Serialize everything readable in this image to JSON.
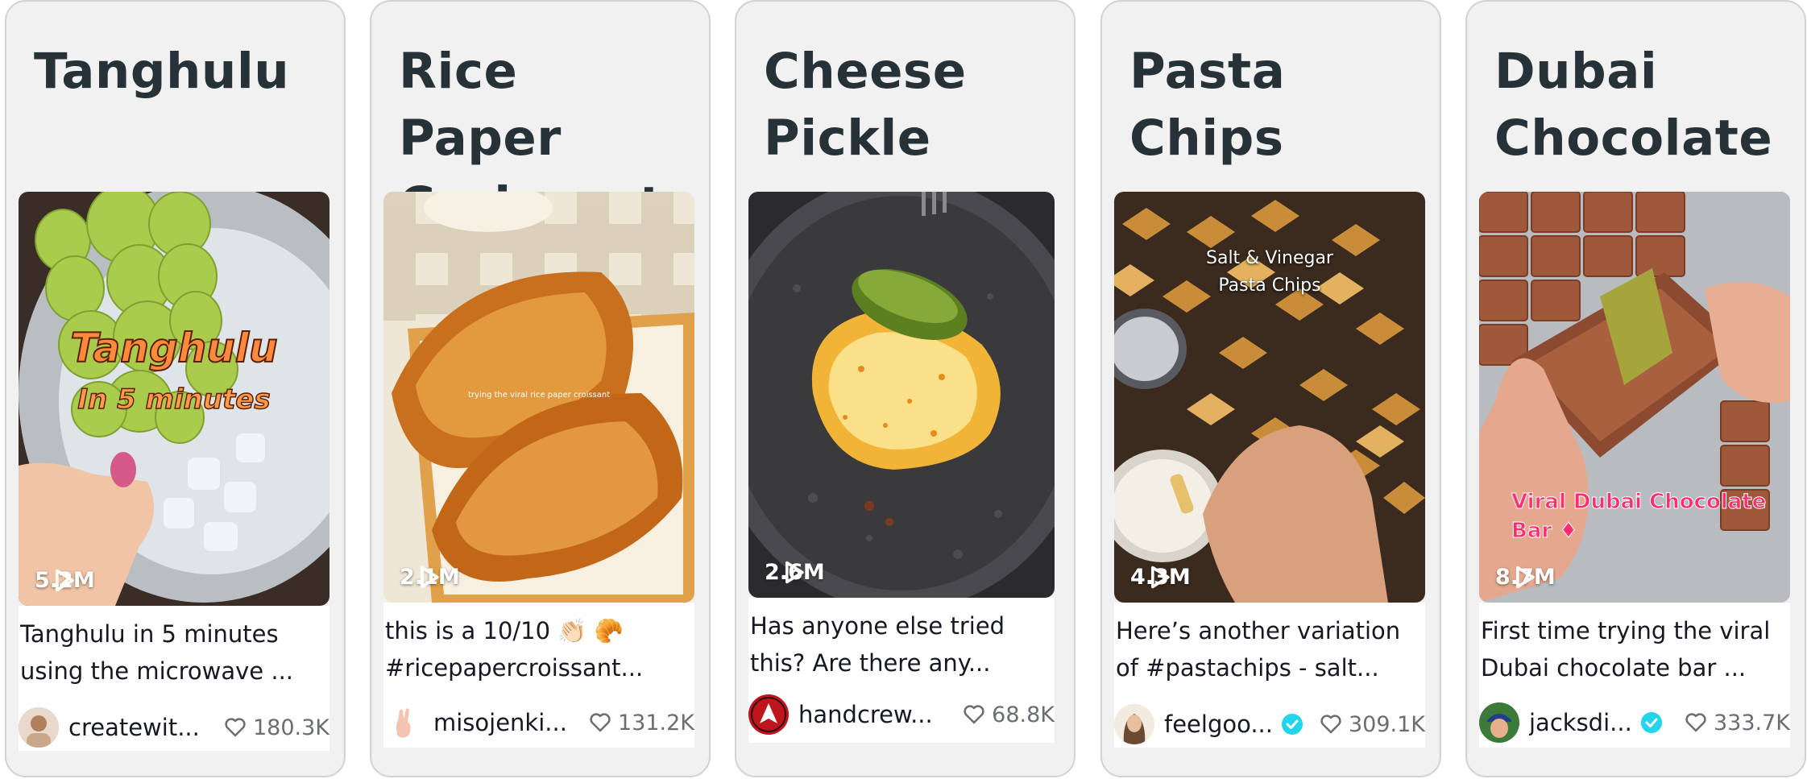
{
  "cards": [
    {
      "title": "Tanghulu",
      "overlay": [
        "Tanghulu",
        "In 5 minutes"
      ],
      "views": "5.2M",
      "caption": "Tanghulu in 5 minutes using the microwave ...",
      "username": "createwit...",
      "likes": "180.3K",
      "verified": false
    },
    {
      "title": "Rice Paper Croissant",
      "overlay": [
        "trying the viral rice paper croissant"
      ],
      "views": "2.1M",
      "caption": "this is a 10/10 👏🏻 🥐 #ricepapercroissant...",
      "username": "misojenki...",
      "likes": "131.2K",
      "verified": false
    },
    {
      "title": "Cheese Pickle",
      "overlay": [],
      "views": "2.6M",
      "caption": "Has anyone else tried this? Are there any...",
      "username": "handcrew...",
      "likes": "68.8K",
      "verified": false
    },
    {
      "title": "Pasta Chips",
      "overlay": [
        "Salt & Vinegar",
        "Pasta Chips"
      ],
      "views": "4.3M",
      "caption": "Here’s another variation of #pastachips - salt...",
      "username": "feelgoo...",
      "likes": "309.1K",
      "verified": true
    },
    {
      "title": "Dubai Chocolate",
      "overlay": [
        "Viral Dubai Chocolate",
        "Bar ♦"
      ],
      "views": "8.7M",
      "caption": "First time trying the viral Dubai chocolate bar ...",
      "username": "jacksdi...",
      "likes": "333.7K",
      "verified": true
    }
  ],
  "icons": {
    "play": "play-icon",
    "heart": "heart-outline-icon",
    "verified": "verified-badge-icon"
  },
  "colors": {
    "card_bg": "#f1f1f2",
    "title": "#263238",
    "verified": "#20d5ec",
    "likes_text": "#6b6d75",
    "dubai_overlay": "#ff2d6f",
    "tanghulu_overlay": "#ff8a3d"
  }
}
